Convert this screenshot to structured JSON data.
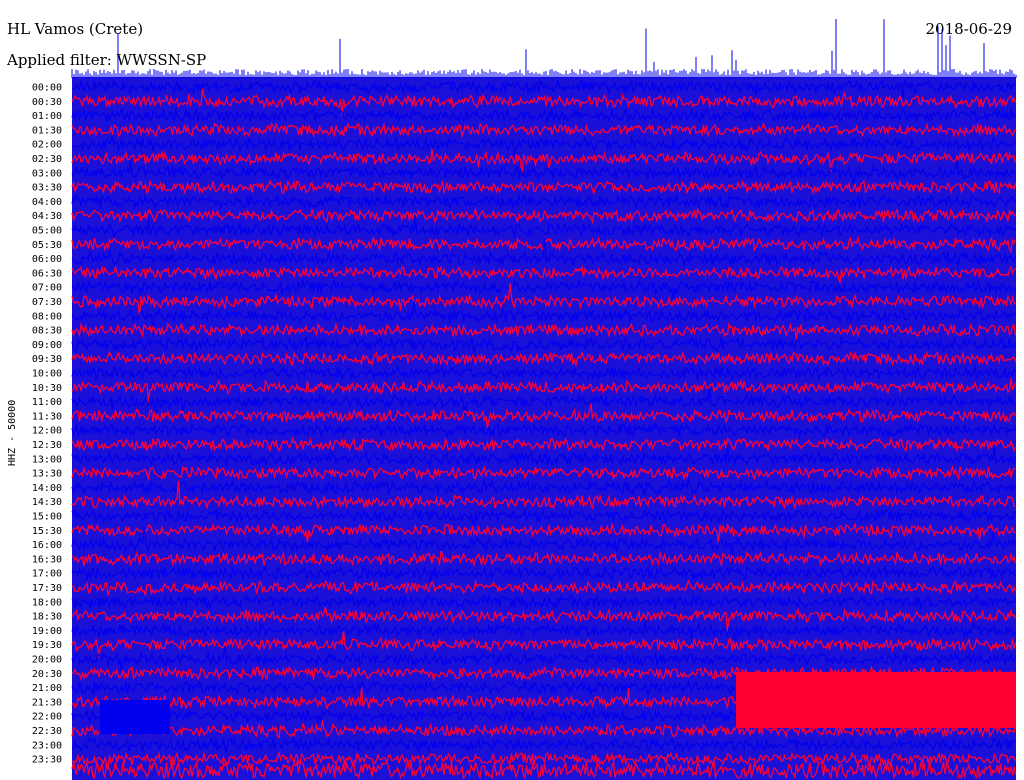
{
  "header": {
    "station": "HL Vamos (Crete)",
    "date": "2018-06-29",
    "filter": "Applied filter: WWSSN-SP"
  },
  "chart_data": {
    "type": "line",
    "title": "HL Vamos (Crete)",
    "subtitle": "Applied filter: WWSSN-SP",
    "ylabel": "HHZ - 50000",
    "xlabel": "",
    "y_ticks": [
      "00:00",
      "00:30",
      "01:00",
      "01:30",
      "02:00",
      "02:30",
      "03:00",
      "03:30",
      "04:00",
      "04:30",
      "05:00",
      "05:30",
      "06:00",
      "06:30",
      "07:00",
      "07:30",
      "08:00",
      "08:30",
      "09:00",
      "09:30",
      "10:00",
      "10:30",
      "11:00",
      "11:30",
      "12:00",
      "12:30",
      "13:00",
      "13:30",
      "14:00",
      "14:30",
      "15:00",
      "15:30",
      "16:00",
      "16:30",
      "17:00",
      "17:30",
      "18:00",
      "18:30",
      "19:00",
      "19:30",
      "20:00",
      "20:30",
      "21:00",
      "21:30",
      "22:00",
      "22:30",
      "23:00",
      "23:30"
    ],
    "series_colors": [
      "#0000ee",
      "#ff0033"
    ],
    "grid": false,
    "legend": "none"
  }
}
